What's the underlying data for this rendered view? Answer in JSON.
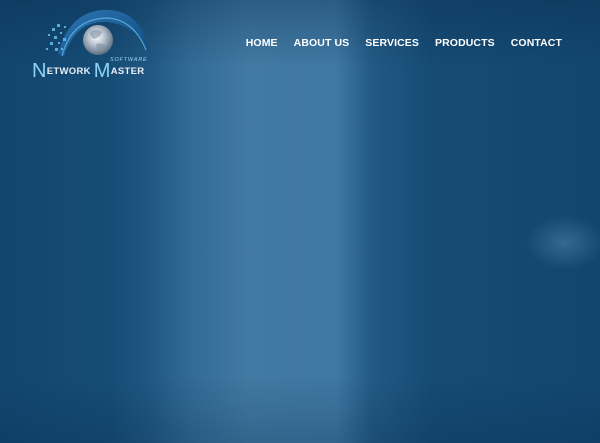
{
  "brand": {
    "logo_word_1_initial": "N",
    "logo_word_1_rest": "ETWORK",
    "logo_word_2_initial": "M",
    "logo_word_2_rest": "ASTER",
    "logo_tagline": "SOFTWARE"
  },
  "nav": {
    "items": [
      {
        "label": "HOME"
      },
      {
        "label": "ABOUT US"
      },
      {
        "label": "SERVICES"
      },
      {
        "label": "PRODUCTS"
      },
      {
        "label": "CONTACT"
      }
    ]
  },
  "colors": {
    "background": "#134a72",
    "accent": "#8fd3f5",
    "nav_text": "#ffffff"
  }
}
